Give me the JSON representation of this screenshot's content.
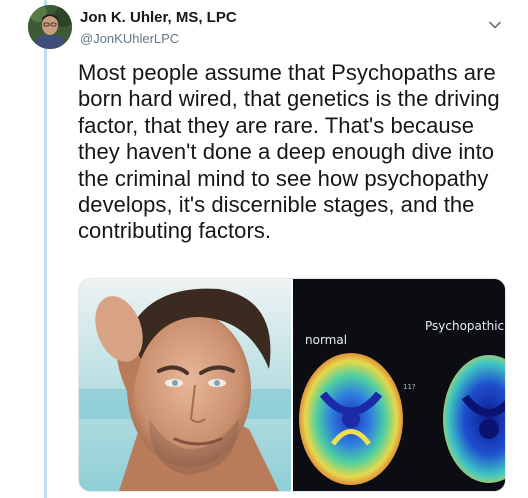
{
  "tweet": {
    "author": {
      "display_name": "Jon K. Uhler, MS, LPC",
      "handle": "@JonKUhlerLPC"
    },
    "text": "Most people assume that Psychopaths are born hard wired, that genetics is the driving factor, that they are rare. That's because they haven't done a deep enough dive into the criminal mind to see how psychopathy develops, it's discernible stages, and the contributing factors.",
    "media": {
      "scan_labels": {
        "normal": "normal",
        "psychopathic": "Psychopathic",
        "middle": "11?"
      }
    }
  },
  "icons": {
    "caret": "chevron-down-icon"
  },
  "colors": {
    "thread_line": "#c4dcee",
    "secondary_text": "#657786",
    "primary_text": "#14171a"
  }
}
